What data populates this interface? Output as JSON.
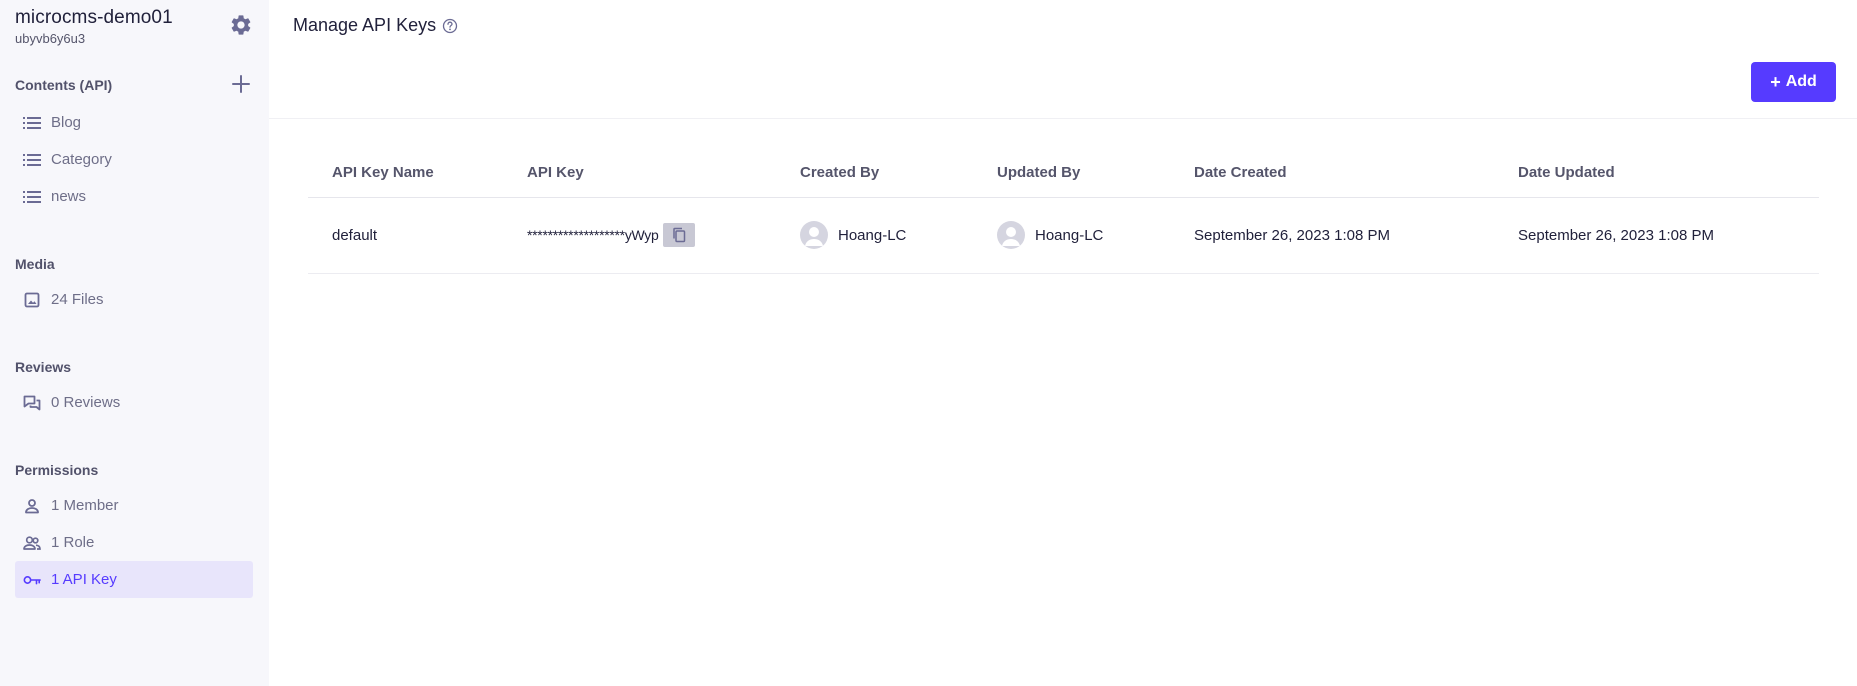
{
  "service": {
    "name": "microcms-demo01",
    "id": "ubyvb6y6u3"
  },
  "sidebar": {
    "contents_title": "Contents (API)",
    "contents": [
      {
        "label": "Blog",
        "icon": "list-icon"
      },
      {
        "label": "Category",
        "icon": "list-icon"
      },
      {
        "label": "news",
        "icon": "list-icon"
      }
    ],
    "media_title": "Media",
    "media": [
      {
        "label": "24 Files",
        "icon": "image-icon"
      }
    ],
    "reviews_title": "Reviews",
    "reviews": [
      {
        "label": "0 Reviews",
        "icon": "reviews-icon"
      }
    ],
    "permissions_title": "Permissions",
    "permissions": [
      {
        "label": "1 Member",
        "icon": "person-icon"
      },
      {
        "label": "1 Role",
        "icon": "people-icon"
      },
      {
        "label": "1 API Key",
        "icon": "key-icon",
        "active": true
      }
    ]
  },
  "main": {
    "title": "Manage API Keys",
    "add_label": "Add"
  },
  "table": {
    "headers": [
      "API Key Name",
      "API Key",
      "Created By",
      "Updated By",
      "Date Created",
      "Date Updated"
    ],
    "rows": [
      {
        "name": "default",
        "key": "*******************yWyp",
        "created_by": "Hoang-LC",
        "updated_by": "Hoang-LC",
        "date_created": "September 26, 2023 1:08 PM",
        "date_updated": "September 26, 2023 1:08 PM"
      }
    ]
  },
  "colors": {
    "accent": "#563bff",
    "sidebar_bg": "#f7f7fb",
    "active_bg": "#e8e5fb",
    "icon": "#6b6b94"
  }
}
